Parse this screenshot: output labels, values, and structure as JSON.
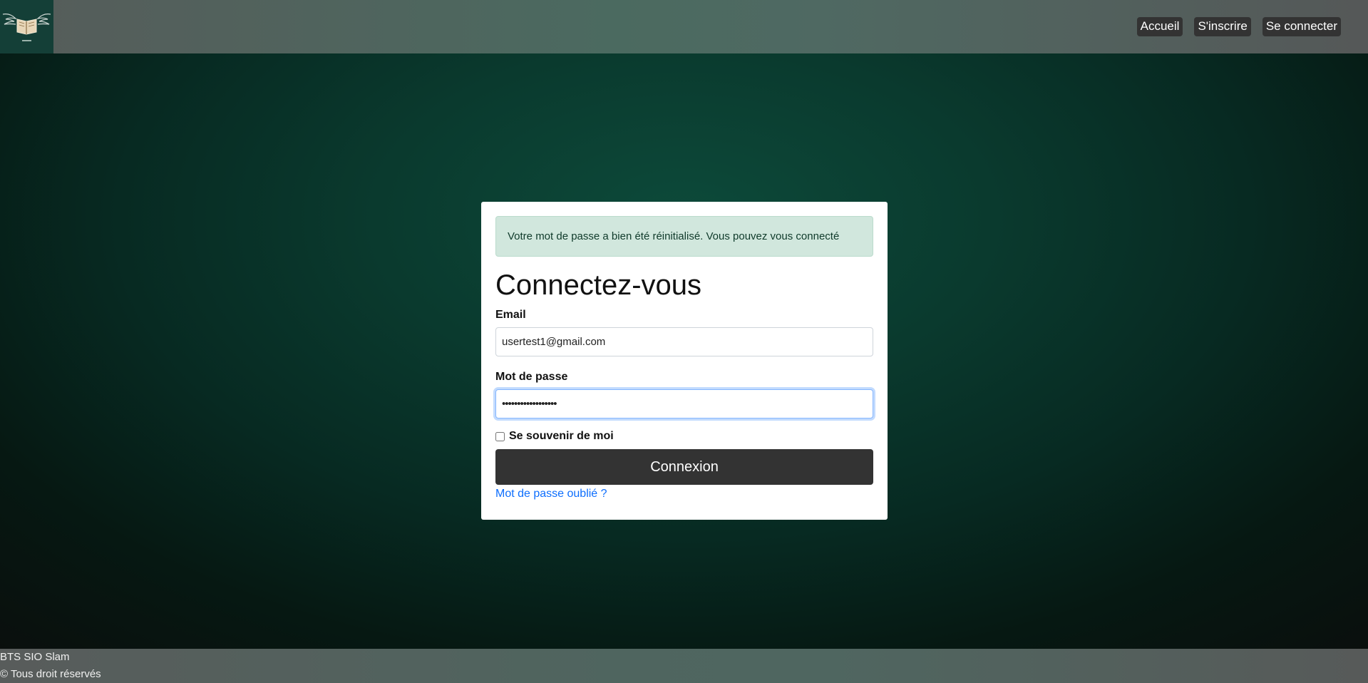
{
  "header": {
    "logo_icon": "book-wings-logo",
    "nav": [
      {
        "label": "Accueil"
      },
      {
        "label": "S'inscrire"
      },
      {
        "label": "Se connecter"
      }
    ]
  },
  "alert": {
    "text": "Votre mot de passe a bien été réinitialisé. Vous pouvez vous connecté"
  },
  "form": {
    "title": "Connectez-vous",
    "email_label": "Email",
    "email_value": "usertest1@gmail.com",
    "password_label": "Mot de passe",
    "password_value": "••••••••••••••••••",
    "remember_label": "Se souvenir de moi",
    "submit_label": "Connexion",
    "forgot_label": "Mot de passe oublié ?"
  },
  "footer": {
    "line1": "BTS SIO Slam",
    "line2": "© Tous droit réservés"
  },
  "colors": {
    "button": "#333333",
    "link": "#0d6efd",
    "alert_bg": "#d1e7dd"
  }
}
